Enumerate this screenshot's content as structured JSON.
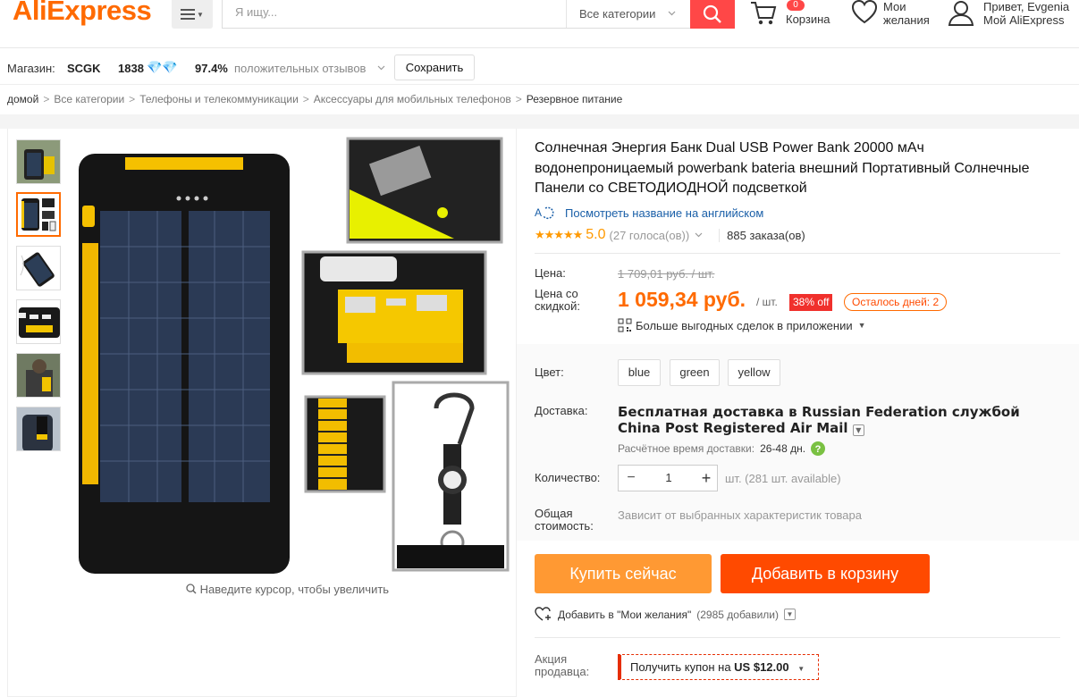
{
  "header": {
    "logo": "AliExpress",
    "logo_tm": "™",
    "search_placeholder": "Я ищу...",
    "category": "Все категории",
    "cart_count": "0",
    "cart_label": "Корзина",
    "wishlist_line1": "Мои",
    "wishlist_line2": "желания",
    "account_line1": "Привет, Evgenia",
    "account_line2": "Мой AliExpress"
  },
  "store": {
    "label": "Магазин:",
    "name": "SCGK",
    "score": "1838",
    "positive_pct": "97.4%",
    "positive_label": "положительных отзывов",
    "save_label": "Сохранить"
  },
  "breadcrumb": [
    "домой",
    "Все категории",
    "Телефоны и телекоммуникации",
    "Аксессуары для мобильных телефонов",
    "Резервное питание"
  ],
  "breadcrumb_sep": ">",
  "gallery": {
    "zoom_hint": "Наведите курсор, чтобы увеличить",
    "thumb_count": 6,
    "active_thumb": 2
  },
  "product": {
    "title": "Солнечная Энергия Банк Dual USB Power Bank 20000 мАч водонепроницаемый powerbank bateria внешний Портативный Солнечные Панели со СВЕТОДИОДНОЙ подсветкой",
    "translate_link": "Посмотреть название на английском",
    "stars": "★★★★★",
    "rating": "5.0",
    "votes": "(27 голоса(ов))",
    "orders": "885 заказа(ов)",
    "price_label": "Цена:",
    "old_price": "1 709,01 руб. / шт.",
    "discount_label_1": "Цена со",
    "discount_label_2": "скидкой:",
    "new_price": "1 059,34 руб.",
    "unit": "/ шт.",
    "discount": "38% off",
    "days_left": "Осталось дней: 2",
    "app_deals": "Больше выгодных сделок в приложении",
    "color_label": "Цвет:",
    "colors": [
      "blue",
      "green",
      "yellow"
    ],
    "shipping_label": "Доставка:",
    "shipping_text": "Бесплатная доставка в Russian Federation службой China Post Registered Air Mail",
    "shipping_est_label": "Расчётное время доставки:",
    "shipping_est_value": "26-48 дн.",
    "qty_label": "Количество:",
    "qty_value": "1",
    "qty_avail": "шт. (281 шт. available)",
    "total_label_1": "Общая",
    "total_label_2": "стоимость:",
    "total_text": "Зависит от выбранных характеристик товара",
    "buy_now": "Купить сейчас",
    "add_to_cart": "Добавить в корзину",
    "wishlist_add": "Добавить в \"Мои желания\"",
    "wishlist_count": "(2985 добавили)",
    "promo_label_1": "Акция",
    "promo_label_2": "продавца:",
    "coupon_prefix": "Получить купон на ",
    "coupon_amount": "US $12.00"
  },
  "colors": {
    "brand_orange": "#ff6a00",
    "search_red": "#ff4747",
    "buy_now_bg": "#ff9933",
    "add_cart_bg": "#ff4a00",
    "link_blue": "#1a5fa8",
    "star_yellow": "#ff9900"
  },
  "icons": [
    "menu-icon",
    "search-icon",
    "cart-icon",
    "heart-icon",
    "user-icon",
    "diamond-icon",
    "translate-icon",
    "qr-icon",
    "question-icon",
    "heart-plus-icon",
    "magnifier-icon"
  ]
}
